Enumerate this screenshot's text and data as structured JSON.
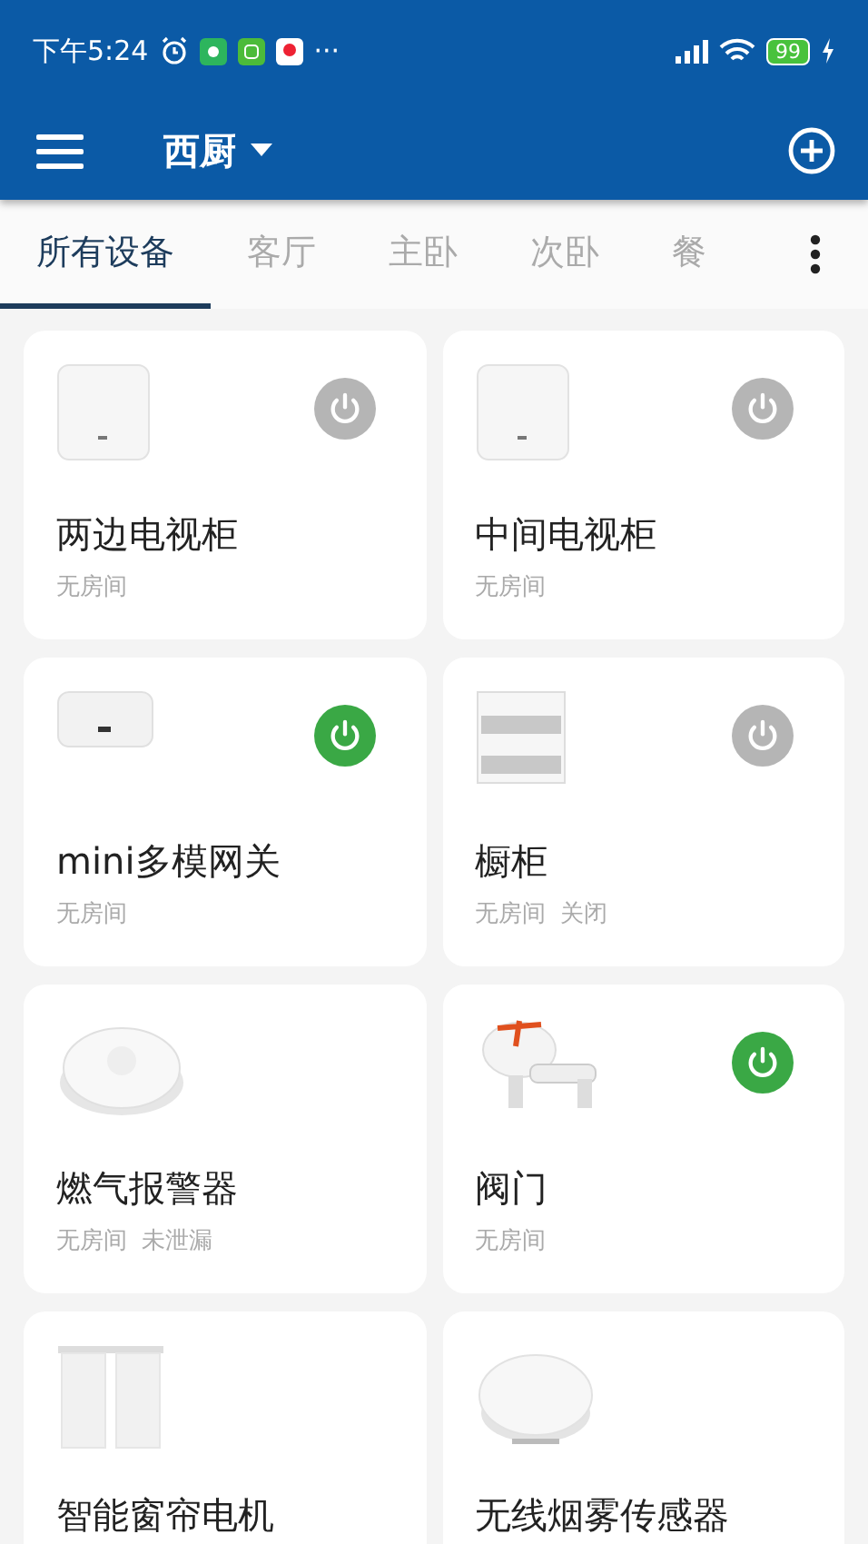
{
  "status_bar": {
    "time": "下午5:24",
    "more": "···",
    "battery": "99"
  },
  "app_bar": {
    "home": "西厨"
  },
  "tabs": [
    {
      "label": "所有设备",
      "selected": true
    },
    {
      "label": "客厅",
      "selected": false
    },
    {
      "label": "主卧",
      "selected": false
    },
    {
      "label": "次卧",
      "selected": false
    },
    {
      "label": "餐",
      "selected": false
    }
  ],
  "devices": [
    {
      "kind": "router",
      "name": "两边电视柜",
      "room": "无房间",
      "power_on": false
    },
    {
      "kind": "router",
      "name": "中间电视柜",
      "room": "无房间",
      "power_on": false
    },
    {
      "kind": "hub",
      "name": "mini多模网关",
      "room": "无房间",
      "power_on": true
    },
    {
      "kind": "cabinet",
      "name": "橱柜",
      "room": "无房间",
      "status": "关闭",
      "power_on": false
    },
    {
      "kind": "detector",
      "name": "燃气报警器",
      "room": "无房间",
      "status": "未泄漏"
    },
    {
      "kind": "valve",
      "name": "阀门",
      "room": "无房间",
      "power_on": true
    },
    {
      "kind": "curtain",
      "name": "智能窗帘电机"
    },
    {
      "kind": "smoke",
      "name": "无线烟雾传感器"
    }
  ]
}
